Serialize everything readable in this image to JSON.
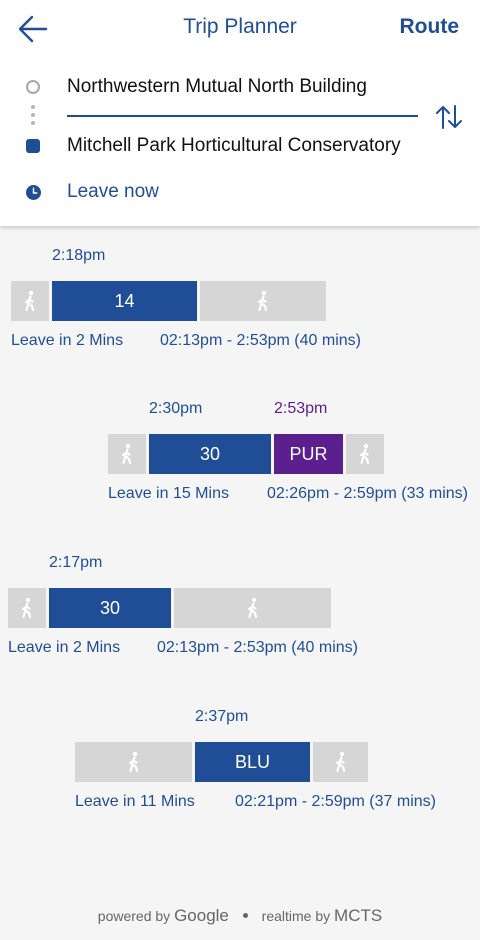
{
  "header": {
    "title": "Trip Planner",
    "route_label": "Route",
    "origin": "Northwestern Mutual North Building",
    "destination": "Mitchell Park Horticultural Conservatory",
    "leave_label": "Leave now"
  },
  "icons": {
    "back": "arrow-left-icon",
    "swap": "swap-vertical-icon",
    "clock": "clock-icon",
    "walk": "walking-person-icon",
    "origin": "origin-circle-icon",
    "destination": "destination-square-icon"
  },
  "colors": {
    "primary": "#1f4e96",
    "purple_line": "#5b1f8e",
    "walk_segment": "#d6d6d6",
    "background": "#f5f5f5"
  },
  "trips": [
    {
      "times": [
        "2:18pm"
      ],
      "segments": [
        {
          "type": "walk"
        },
        {
          "type": "bus",
          "label": "14",
          "color": "blue"
        },
        {
          "type": "walk"
        }
      ],
      "leave": "Leave in 2 Mins",
      "range": "02:13pm - 2:53pm (40 mins)"
    },
    {
      "times": [
        "2:30pm",
        "2:53pm"
      ],
      "segments": [
        {
          "type": "walk"
        },
        {
          "type": "bus",
          "label": "30",
          "color": "blue"
        },
        {
          "type": "bus",
          "label": "PUR",
          "color": "purple"
        },
        {
          "type": "walk"
        }
      ],
      "leave": "Leave in 15 Mins",
      "range": "02:26pm - 2:59pm (33 mins)"
    },
    {
      "times": [
        "2:17pm"
      ],
      "segments": [
        {
          "type": "walk"
        },
        {
          "type": "bus",
          "label": "30",
          "color": "blue"
        },
        {
          "type": "walk"
        }
      ],
      "leave": "Leave in 2 Mins",
      "range": "02:13pm - 2:53pm (40 mins)"
    },
    {
      "times": [
        "2:37pm"
      ],
      "segments": [
        {
          "type": "walk"
        },
        {
          "type": "bus",
          "label": "BLU",
          "color": "blue"
        },
        {
          "type": "walk"
        }
      ],
      "leave": "Leave in 11 Mins",
      "range": "02:21pm - 2:59pm (37 mins)"
    }
  ],
  "footer": {
    "powered_by": "powered by",
    "google": "Google",
    "realtime_by": "realtime by",
    "mcts": "MCTS"
  }
}
